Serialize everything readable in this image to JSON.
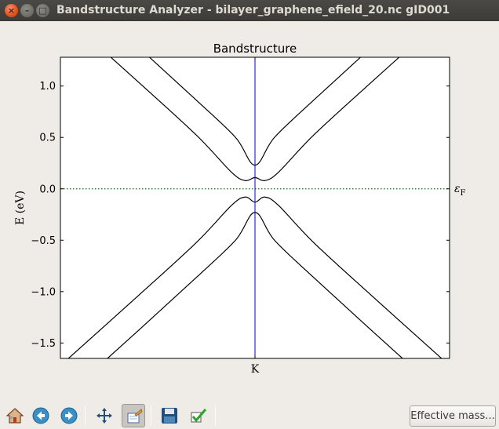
{
  "window": {
    "title": "Bandstructure Analyzer - bilayer_graphene_efield_20.nc gID001",
    "close_glyph": "×",
    "minimize_glyph": "–",
    "maximize_glyph": "□"
  },
  "chart_data": {
    "type": "line",
    "title": "Bandstructure",
    "ylabel": "E (eV)",
    "xtick_labels": [
      "K"
    ],
    "ylim": [
      -1.65,
      1.28
    ],
    "yticks": [
      1.0,
      0.5,
      0.0,
      -0.5,
      -1.0,
      -1.5
    ],
    "ytick_labels": [
      "1.0",
      "0.5",
      "0.0",
      "−0.5",
      "−1.0",
      "−1.5"
    ],
    "fermi_level": 0.0,
    "fermi_label": "ε",
    "fermi_label_sub": "F",
    "k_point_line": "K",
    "grid": false,
    "colors": {
      "bands": "#000000",
      "k_line": "#0000cc",
      "fermi": "#008000"
    },
    "series": [
      {
        "values": [
          [
            -1.0,
            2.06
          ],
          [
            -0.6,
            1.38
          ],
          [
            -0.3,
            0.86
          ],
          [
            -0.1,
            0.5
          ],
          [
            0.0,
            0.23
          ],
          [
            0.1,
            0.5
          ],
          [
            0.3,
            0.86
          ],
          [
            0.6,
            1.38
          ],
          [
            1.0,
            2.06
          ]
        ]
      },
      {
        "values": [
          [
            -1.0,
            1.72
          ],
          [
            -0.6,
            1.04
          ],
          [
            -0.3,
            0.52
          ],
          [
            -0.12,
            0.16
          ],
          [
            -0.05,
            0.08
          ],
          [
            0.0,
            0.11
          ],
          [
            0.05,
            0.08
          ],
          [
            0.12,
            0.16
          ],
          [
            0.3,
            0.52
          ],
          [
            0.6,
            1.04
          ],
          [
            1.0,
            1.72
          ]
        ]
      },
      {
        "values": [
          [
            -1.0,
            -1.72
          ],
          [
            -0.6,
            -1.04
          ],
          [
            -0.3,
            -0.52
          ],
          [
            -0.12,
            -0.16
          ],
          [
            -0.05,
            -0.08
          ],
          [
            0.0,
            -0.13
          ],
          [
            0.05,
            -0.08
          ],
          [
            0.12,
            -0.16
          ],
          [
            0.3,
            -0.52
          ],
          [
            0.6,
            -1.04
          ],
          [
            1.0,
            -1.72
          ]
        ]
      },
      {
        "values": [
          [
            -1.0,
            -2.06
          ],
          [
            -0.6,
            -1.38
          ],
          [
            -0.3,
            -0.86
          ],
          [
            -0.1,
            -0.5
          ],
          [
            0.0,
            -0.23
          ],
          [
            0.1,
            -0.5
          ],
          [
            0.3,
            -0.86
          ],
          [
            0.6,
            -1.38
          ],
          [
            1.0,
            -2.06
          ]
        ]
      }
    ]
  },
  "toolbar": {
    "items": [
      "home-icon",
      "back-arrow-icon",
      "forward-arrow-icon",
      "pan-icon",
      "zoom-icon",
      "save-icon",
      "checkmark-icon"
    ],
    "effective_mass_label": "Effective mass..."
  }
}
